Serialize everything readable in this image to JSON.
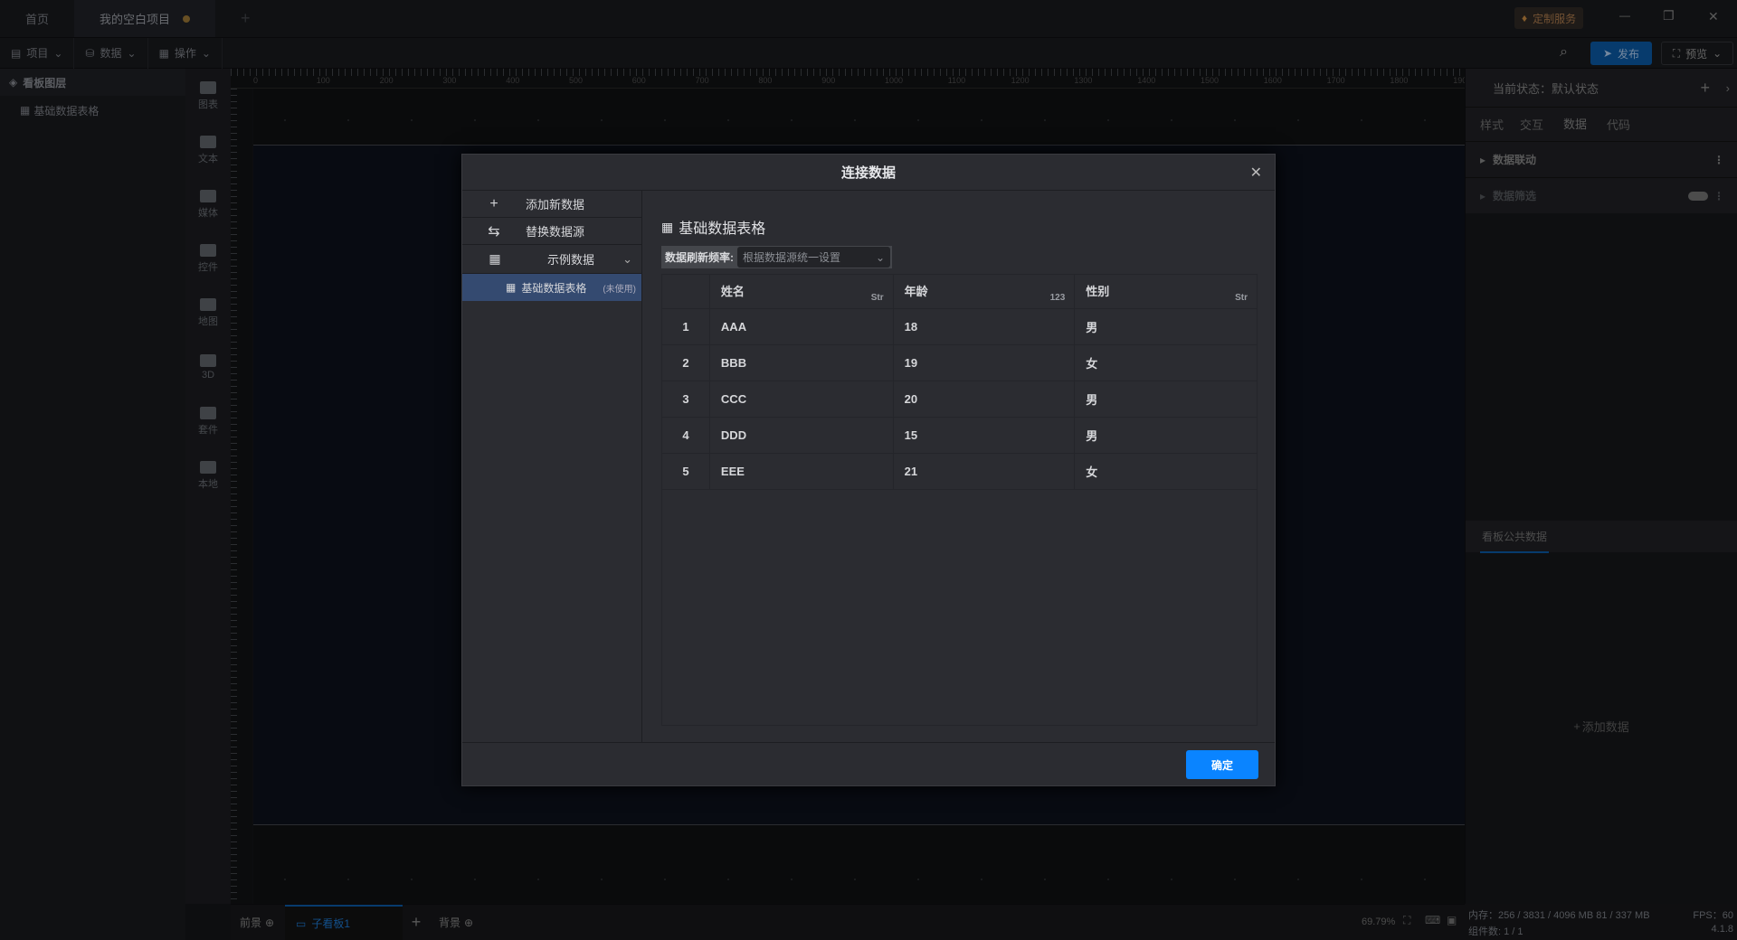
{
  "tabs": {
    "home": "首页",
    "project": "我的空白项目",
    "add": "+"
  },
  "titlebar": {
    "custom_service": "定制服务",
    "minimize": "—",
    "restore": "❐",
    "close": "✕"
  },
  "toolbar": {
    "project": "项目",
    "data": "数据",
    "operate": "操作",
    "publish": "发布",
    "preview": "预览"
  },
  "layers": {
    "title": "看板图层",
    "items": [
      {
        "label": "基础数据表格"
      }
    ]
  },
  "iconbar": [
    {
      "label": "图表"
    },
    {
      "label": "文本"
    },
    {
      "label": "媒体"
    },
    {
      "label": "控件"
    },
    {
      "label": "地图"
    },
    {
      "label": "3D"
    },
    {
      "label": "套件"
    },
    {
      "label": "本地"
    }
  ],
  "ruler": {
    "top": [
      "0",
      "100",
      "200",
      "300",
      "400",
      "500",
      "600",
      "700",
      "800",
      "900",
      "1000",
      "1100",
      "1200",
      "1300",
      "1400",
      "1500",
      "1600",
      "1700",
      "1800",
      "1900"
    ]
  },
  "bottom": {
    "foreground": "前景",
    "sub_board": "子看板1",
    "background": "背景",
    "add": "+",
    "zoom": "69.79%"
  },
  "status": {
    "memory": "内存：256 / 3831 / 4096 MB  81 / 337 MB",
    "fps": "FPS：60",
    "components": "组件数: 1 / 1",
    "version": "4.1.8"
  },
  "rightpanel": {
    "state_label": "当前状态：默认状态",
    "tabs": [
      "样式",
      "交互",
      "数据",
      "代码"
    ],
    "active_tab": "数据",
    "sections": [
      {
        "label": "数据联动"
      },
      {
        "label": "数据筛选"
      }
    ],
    "public_tab": "看板公共数据",
    "add_data": "添加数据"
  },
  "dialog": {
    "title": "连接数据",
    "menu": {
      "add_new": "添加新数据",
      "replace": "替换数据源",
      "sample": "示例数据",
      "selected_item": "基础数据表格",
      "selected_status": "(未使用)"
    },
    "content_title": "基础数据表格",
    "refresh_label": "数据刷新频率:",
    "refresh_value": "根据数据源统一设置",
    "columns": [
      {
        "name": "姓名",
        "type": "Str"
      },
      {
        "name": "年龄",
        "type": "123"
      },
      {
        "name": "性别",
        "type": "Str"
      }
    ],
    "rows": [
      [
        "1",
        "AAA",
        "18",
        "男"
      ],
      [
        "2",
        "BBB",
        "19",
        "女"
      ],
      [
        "3",
        "CCC",
        "20",
        "男"
      ],
      [
        "4",
        "DDD",
        "15",
        "男"
      ],
      [
        "5",
        "EEE",
        "21",
        "女"
      ]
    ],
    "confirm": "确定"
  },
  "colors": {
    "accent": "#0a84ff",
    "selected": "#344a70"
  }
}
